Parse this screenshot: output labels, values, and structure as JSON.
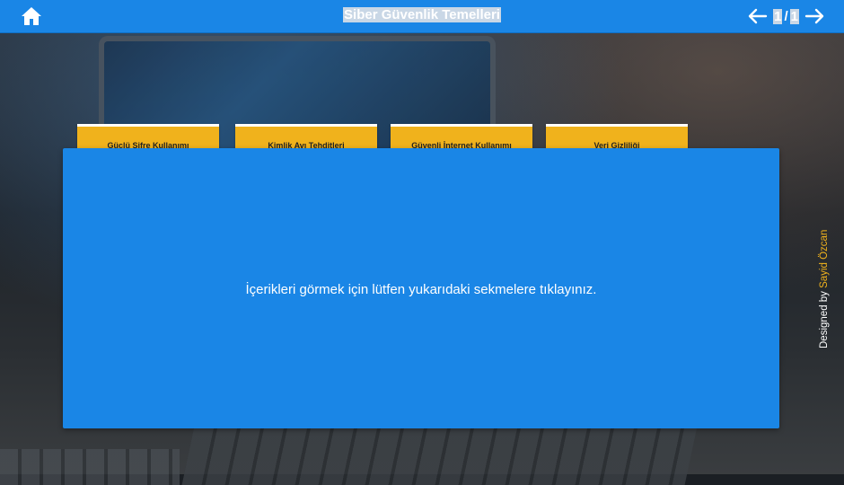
{
  "header": {
    "title": "Siber Güvenlik Temelleri",
    "page_current": "1",
    "page_separator": "/",
    "page_total": "1"
  },
  "icons": {
    "home": "home-icon",
    "prev": "arrow-left-icon",
    "next": "arrow-right-icon"
  },
  "tabs": [
    {
      "label": "Güçlü Şifre Kullanımı"
    },
    {
      "label": "Kimlik Avı Tehditleri"
    },
    {
      "label": "Güvenli İnternet Kullanımı"
    },
    {
      "label": "Veri Gizliliği"
    }
  ],
  "panel": {
    "message": "İçerikleri görmek için lütfen yukarıdaki sekmelere tıklayınız."
  },
  "credit": {
    "prefix": "Designed by",
    "author": "Sayid Özcan"
  },
  "colors": {
    "primary": "#1a86e6",
    "tab": "#f0b21c",
    "text": "#ffffff"
  }
}
